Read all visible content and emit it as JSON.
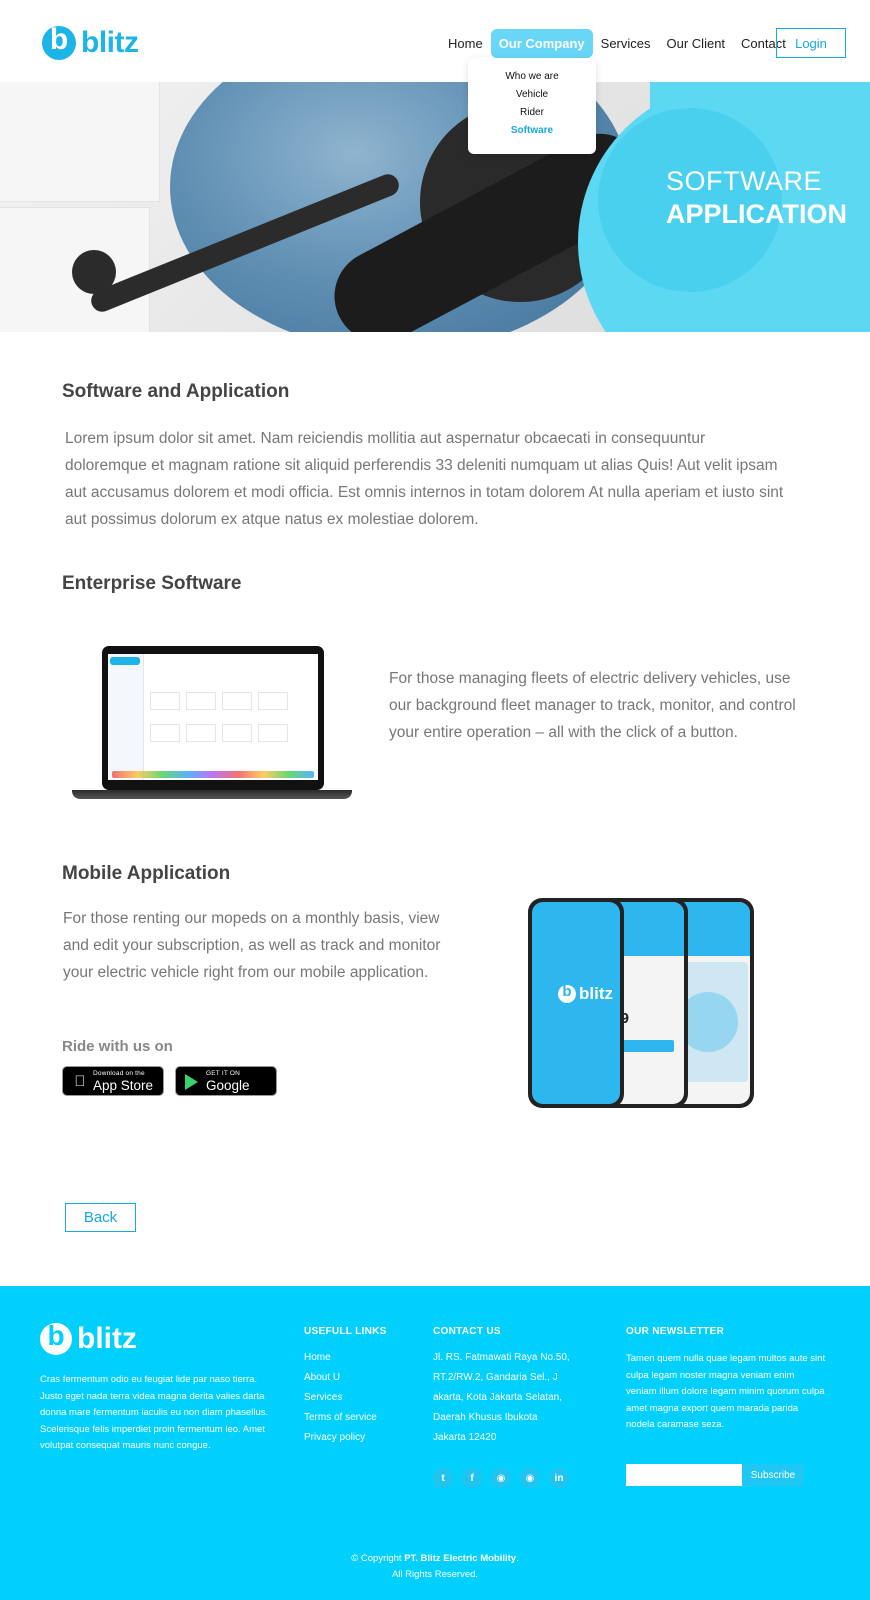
{
  "header": {
    "logo_text": "blitz",
    "nav": [
      "Home",
      "Our Company",
      "Services",
      "Our Client",
      "Contact"
    ],
    "active_nav": "Our Company",
    "login_label": "Login",
    "dropdown": [
      "Who we are",
      "Vehicle",
      "Rider",
      "Software"
    ],
    "active_dropdown": "Software"
  },
  "hero": {
    "title_line1": "SOFTWARE",
    "title_line2": "APPLICATION"
  },
  "intro": {
    "heading": "Software and Application",
    "body": "Lorem ipsum dolor sit amet. Nam reiciendis mollitia aut aspernatur obcaecati in consequuntur doloremque et magnam ratione sit aliquid perferendis 33 deleniti numquam ut alias Quis! Aut velit ipsam aut accusamus dolorem et modi officia. Est omnis internos in totam dolorem At nulla aperiam et iusto sint aut possimus dolorum ex atque natus ex molestiae dolorem."
  },
  "enterprise": {
    "heading": "Enterprise Software",
    "body": "For those managing fleets of electric delivery vehicles, use our background fleet manager to track, monitor, and control your entire operation – all with the click of a button."
  },
  "mobile": {
    "heading": "Mobile Application",
    "body": "For those renting our mopeds on a monthly basis, view and edit your subscription, as well as track and monitor your electric vehicle right from our mobile application.",
    "ride_label": "Ride with us on",
    "app_store_small": "Download on the",
    "app_store_big": "App Store",
    "google_play_small": "GET IT ON",
    "google_play_big": "Google Play",
    "phone_logo_text": "blitz",
    "phone_price": "$99"
  },
  "back_label": "Back",
  "footer": {
    "logo_text": "blitz",
    "about": "Cras fermentum odio eu feugiat lide par naso tierra. Justo eget nada terra videa magna derita valies darta donna mare fermentum iaculis eu non diam phasellus. Scelerisque felis imperdiet proin fermentum leo. Amet volutpat consequat mauris nunc congue.",
    "links_heading": "USEFULL LINKS",
    "links": [
      "Home",
      "About U",
      "Services",
      "Terms of service",
      "Privacy policy"
    ],
    "contact_heading": "CONTACT US",
    "contact_lines": [
      "Jl. RS. Fatmawati Raya No.50,",
      "RT.2/RW.2, Gandaria Sel., J",
      "akarta, Kota Jakarta Selatan,",
      "Daerah Khusus Ibukota",
      "Jakarta 12420"
    ],
    "socials": [
      "twitter-icon",
      "facebook-icon",
      "instagram-icon",
      "instagram-icon",
      "linkedin-icon"
    ],
    "newsletter_heading": "OUR NEWSLETTER",
    "newsletter_text": "Tamen quem nulla quae legam multos aute sint culpa legam noster magna veniam enim veniam illum dolore legam minim quorum culpa amet magna export quem marada parida nodela caramase seza.",
    "subscribe_label": "Subscribe",
    "copyright_prefix": "© Copyright ",
    "copyright_company": "PT. Blitz Electric Mobility",
    "copyright_suffix": ".",
    "rights": "All Rights Reserved."
  }
}
